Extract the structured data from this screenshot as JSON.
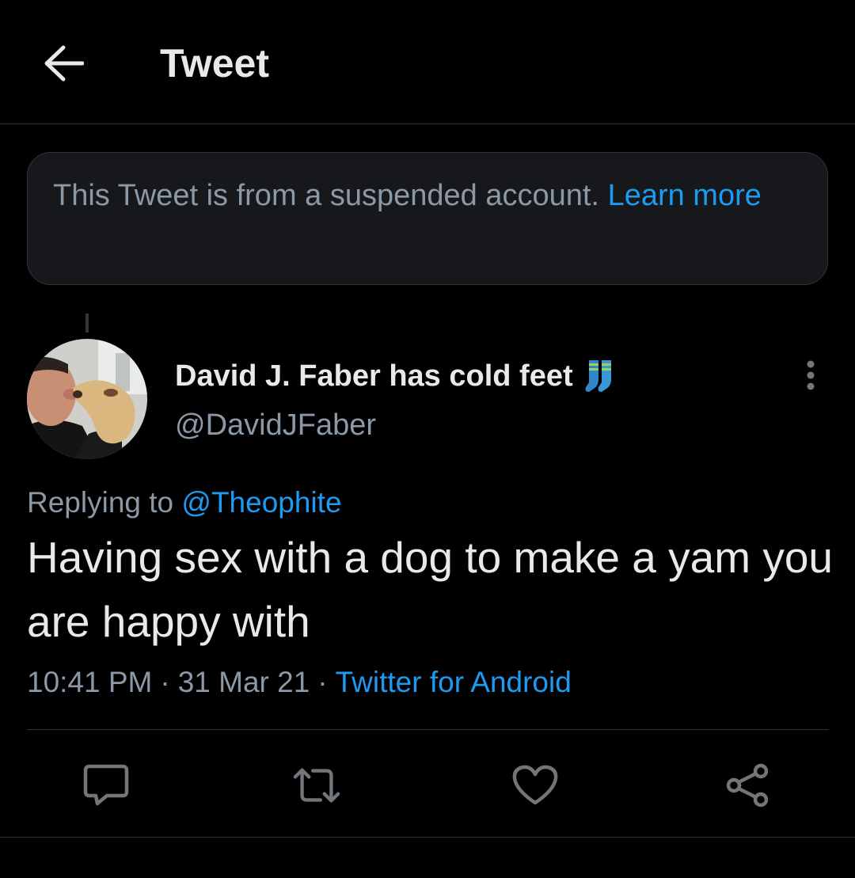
{
  "header": {
    "back_icon": "arrow-left-icon",
    "title": "Tweet"
  },
  "notice": {
    "text": "This Tweet is from a suspended account.",
    "link": "Learn more"
  },
  "tweet": {
    "author": {
      "display_name": "David J. Faber has cold feet",
      "name_emoji": "socks-icon",
      "handle": "@DavidJFaber",
      "avatar": "avatar"
    },
    "replying_prefix": "Replying to",
    "replying_to": "@Theophite",
    "text": "Having sex with a dog to make a yam you are happy with",
    "time": "10:41 PM",
    "date": "31 Mar 21",
    "separator": "·",
    "source": "Twitter for Android",
    "more_icon": "more-vertical-icon"
  },
  "actions": [
    {
      "name": "reply",
      "icon": "reply-icon"
    },
    {
      "name": "retweet",
      "icon": "retweet-icon"
    },
    {
      "name": "like",
      "icon": "heart-icon"
    },
    {
      "name": "share",
      "icon": "share-icon"
    }
  ],
  "colors": {
    "background": "#000000",
    "accent": "#1d9bf0",
    "secondary_text": "#8b98a5",
    "primary_text": "#e7e9ea",
    "notice_bg": "#16181c",
    "border": "#2f3336"
  }
}
